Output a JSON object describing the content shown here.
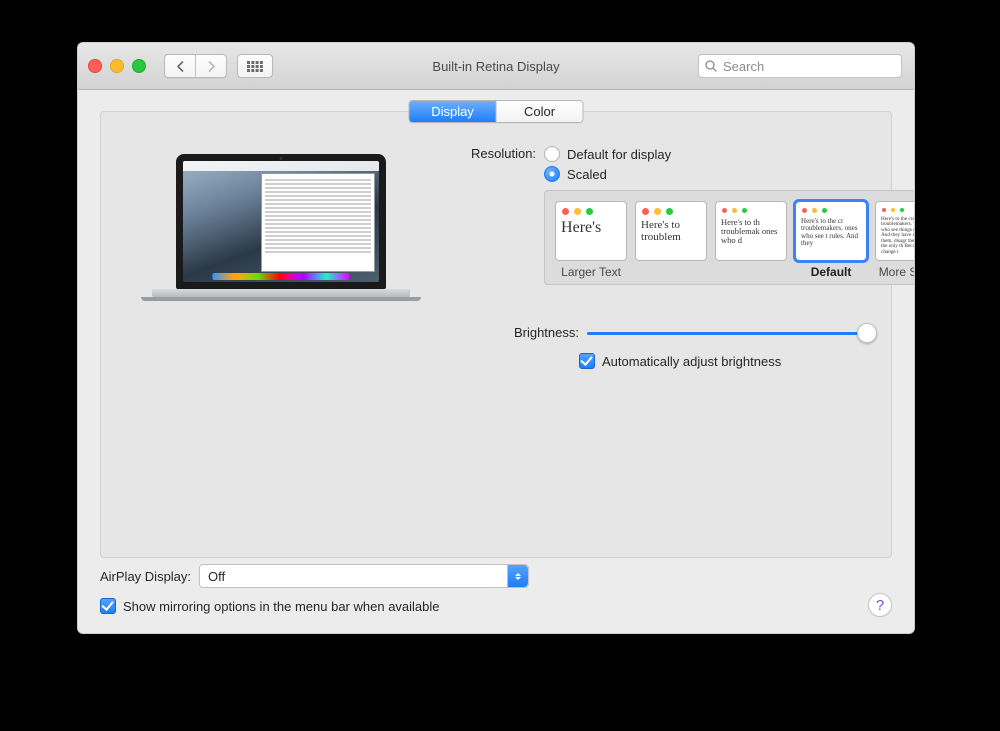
{
  "window": {
    "title": "Built-in Retina Display"
  },
  "search": {
    "placeholder": "Search"
  },
  "tabs": {
    "display": "Display",
    "color": "Color",
    "active": "display"
  },
  "resolution": {
    "label": "Resolution:",
    "option_default": "Default for display",
    "option_scaled": "Scaled",
    "selected": "scaled",
    "scale_options": [
      {
        "caption": "Larger Text",
        "sample": "Here's"
      },
      {
        "caption": "",
        "sample": "Here's to troublem"
      },
      {
        "caption": "",
        "sample": "Here's to th troublemak ones who d"
      },
      {
        "caption": "Default",
        "sample": "Here's to the cr troublemakers. ones who see t rules. And they",
        "selected": true
      },
      {
        "caption": "More Space",
        "sample": "Here's to the crazy one troublemakers. The rou ones who see things dif rules. And they have no can quote them, disagr them. About the only th Because they change t"
      }
    ]
  },
  "brightness": {
    "label": "Brightness:",
    "value_percent": 100,
    "auto_label": "Automatically adjust brightness",
    "auto_checked": true
  },
  "airplay": {
    "label": "AirPlay Display:",
    "value": "Off"
  },
  "mirroring": {
    "label": "Show mirroring options in the menu bar when available",
    "checked": true
  },
  "help": "?"
}
